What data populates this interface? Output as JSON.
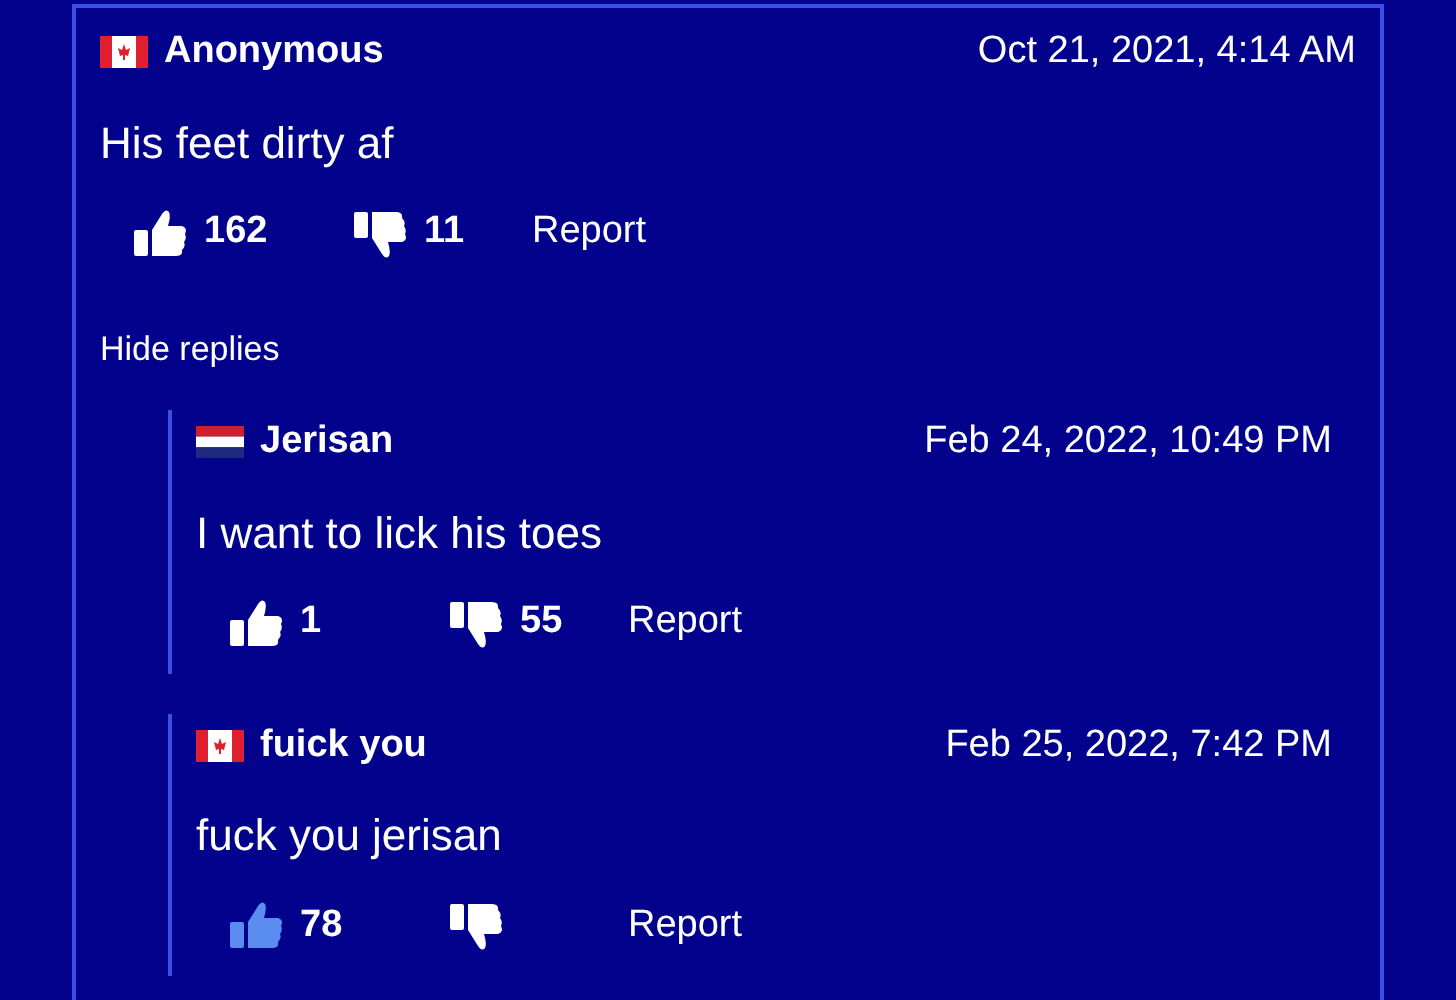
{
  "comment": {
    "flag": {
      "kind": "ca"
    },
    "author": "Anonymous",
    "date": "Oct 21, 2021, 4:14 AM",
    "text": "His feet dirty af",
    "likes": "162",
    "liked": false,
    "dislikes": "11",
    "report": "Report"
  },
  "hide_replies": "Hide replies",
  "replies": [
    {
      "flag": {
        "kind": "nl"
      },
      "author": "Jerisan",
      "date": "Feb 24, 2022, 10:49 PM",
      "text": "I want to lick his toes",
      "likes": "1",
      "liked": false,
      "dislikes": "55",
      "report": "Report"
    },
    {
      "flag": {
        "kind": "ca"
      },
      "author": "fuick you",
      "date": "Feb 25, 2022, 7:42 PM",
      "text": "fuck you jerisan",
      "likes": "78",
      "liked": true,
      "report": "Report"
    }
  ]
}
